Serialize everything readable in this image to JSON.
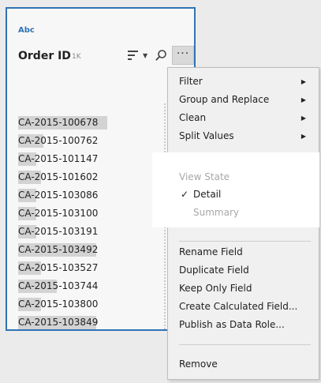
{
  "card": {
    "type_label": "Abc",
    "field_name": "Order ID",
    "count": "1K",
    "sort_caret": "▼",
    "more_label": "···",
    "values": [
      {
        "text": "CA-2015-100678",
        "fraction": 0.63
      },
      {
        "text": "CA-2015-100762",
        "fraction": 0.18
      },
      {
        "text": "CA-2015-101147",
        "fraction": 0.13
      },
      {
        "text": "CA-2015-101602",
        "fraction": 0.16
      },
      {
        "text": "CA-2015-103086",
        "fraction": 0.13
      },
      {
        "text": "CA-2015-103100",
        "fraction": 0.13
      },
      {
        "text": "CA-2015-103191",
        "fraction": 0.13
      },
      {
        "text": "CA-2015-103492",
        "fraction": 0.55
      },
      {
        "text": "CA-2015-103527",
        "fraction": 0.16
      },
      {
        "text": "CA-2015-103744",
        "fraction": 0.27
      },
      {
        "text": "CA-2015-103800",
        "fraction": 0.16
      },
      {
        "text": "CA-2015-103849",
        "fraction": 0.55
      }
    ]
  },
  "menu": {
    "filter": "Filter",
    "group_replace": "Group and Replace",
    "clean": "Clean",
    "split_values": "Split Values",
    "submenu_arrow": "▶",
    "view_state": "View State",
    "checkmark": "✓",
    "detail": "Detail",
    "summary": "Summary",
    "rename": "Rename Field",
    "duplicate": "Duplicate Field",
    "keep_only": "Keep Only Field",
    "calc": "Create Calculated Field...",
    "publish": "Publish as Data Role...",
    "remove": "Remove"
  },
  "colors": {
    "accent": "#2f73b4",
    "disabled_text": "#a8a8a8",
    "value_bar": "#d3d3d3"
  }
}
